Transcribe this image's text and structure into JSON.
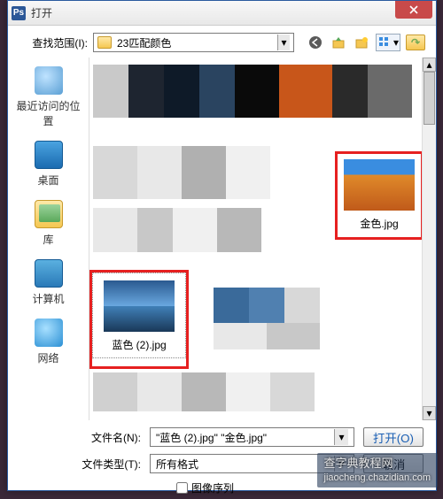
{
  "titlebar": {
    "app_icon": "Ps",
    "title": "打开"
  },
  "lookin": {
    "label": "查找范围(I):",
    "folder": "23匹配颜色"
  },
  "nav": {
    "back": "back-icon",
    "up": "up-icon",
    "newfolder": "new-folder-icon",
    "view": "view-icon",
    "jump": "jump-icon"
  },
  "sidebar": {
    "items": [
      {
        "label": "最近访问的位置"
      },
      {
        "label": "桌面"
      },
      {
        "label": "库"
      },
      {
        "label": "计算机"
      },
      {
        "label": "网络"
      }
    ]
  },
  "files": {
    "gold": {
      "caption": "金色.jpg"
    },
    "blue": {
      "caption": "蓝色 (2).jpg"
    }
  },
  "bottom": {
    "filename_label": "文件名(N):",
    "filename_value": "\"蓝色 (2).jpg\" \"金色.jpg\"",
    "filetype_label": "文件类型(T):",
    "filetype_value": "所有格式",
    "open": "打开(O)",
    "cancel": "取消",
    "image_sequence": "图像序列"
  },
  "watermark": {
    "site": "查字典教程网",
    "url": "jiaocheng.chazidian.com"
  }
}
